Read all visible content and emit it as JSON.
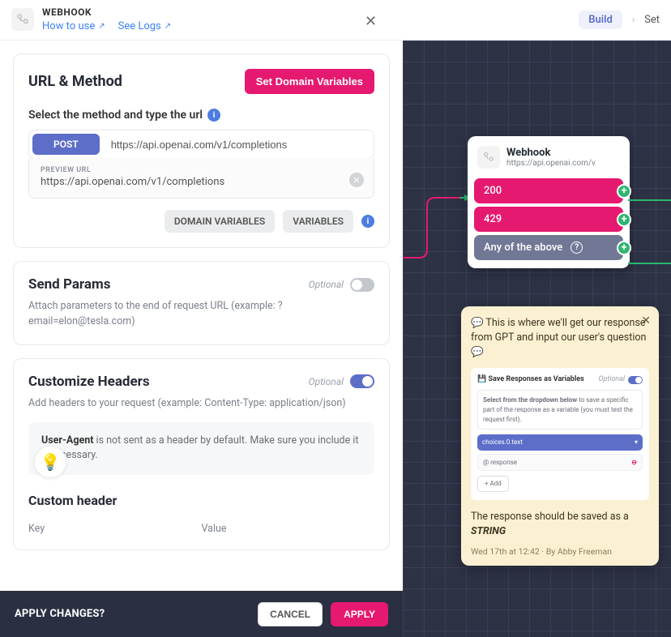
{
  "header": {
    "title": "WEBHOOK",
    "how_to_use": "How to use",
    "see_logs": "See Logs",
    "build": "Build",
    "settings_truncated": "Set"
  },
  "url_method": {
    "title": "URL & Method",
    "set_domain_btn": "Set Domain Variables",
    "field_label": "Select the method and type the url",
    "method": "POST",
    "url": "https://api.openai.com/v1/completions",
    "preview_label": "PREVIEW URL",
    "preview_url": "https://api.openai.com/v1/completions",
    "domain_vars_btn": "DOMAIN VARIABLES",
    "vars_btn": "VARIABLES"
  },
  "send_params": {
    "title": "Send Params",
    "optional": "Optional",
    "desc": "Attach parameters to the end of request URL (example: ?email=elon@tesla.com)"
  },
  "headers": {
    "title": "Customize Headers",
    "optional": "Optional",
    "desc": "Add headers to your request (example: Content-Type: application/json)",
    "notice_strong": "User-Agent",
    "notice_rest": " is not sent as a header by default. Make sure you include it if necessary.",
    "custom_header": "Custom header",
    "key": "Key",
    "value": "Value"
  },
  "footer": {
    "title": "APPLY CHANGES?",
    "cancel": "CANCEL",
    "apply": "APPLY"
  },
  "canvas": {
    "node": {
      "title": "Webhook",
      "sub": "https://api.openai.com/v",
      "out1": "200",
      "out2": "429",
      "out3": "Any of the above"
    },
    "note": {
      "text_before": "💬 This is where we'll get our response from GPT and input our user's question 💬",
      "mini": {
        "title": "Save Responses as Variables",
        "optional": "Optional",
        "hint_strong": "Select from the dropdown below",
        "hint_rest": " to save a specific part of the response as a variable (you must test the request first).",
        "select_val": "choices.0.text",
        "row_val": "@ response",
        "add": "+  Add"
      },
      "foot_pre": "The response should be saved as a ",
      "foot_strong": "STRING",
      "meta": "Wed 17th at 12:42 · By Abby Freeman"
    }
  }
}
